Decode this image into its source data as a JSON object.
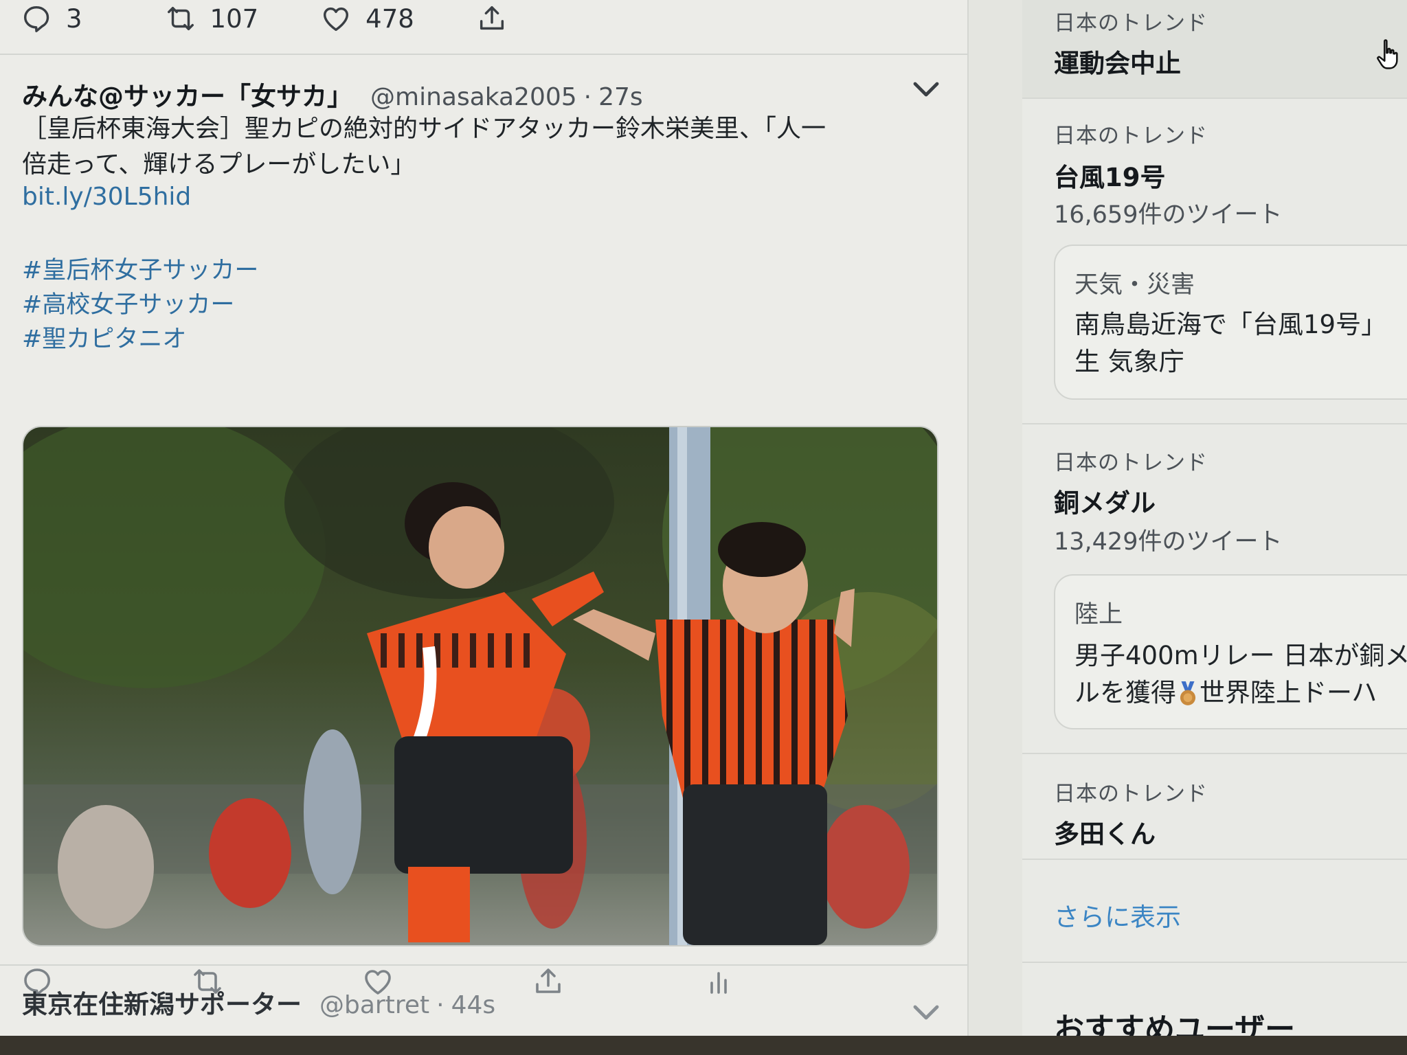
{
  "top_actions": {
    "reply_count": "3",
    "retweet_count": "107",
    "like_count": "478"
  },
  "tweet": {
    "author": "みんな@サッカー「女サカ」",
    "handle": "@minasaka2005",
    "separator": "·",
    "time": "27s",
    "text_line1": "［皇后杯東海大会］聖カピの絶対的サイドアタッカー鈴木栄美里、「人一",
    "text_line2": "倍走って、輝けるプレーがしたい」",
    "link": "bit.ly/30L5hid",
    "hashtags": [
      "#皇后杯女子サッカー",
      "#高校女子サッカー",
      "#聖カピタニオ"
    ]
  },
  "next_tweet": {
    "author": "東京在住新潟サポーター",
    "handle": "@bartret",
    "separator": "·",
    "time": "44s"
  },
  "sidebar": {
    "trend1": {
      "label": "日本のトレンド",
      "name": "運動会中止"
    },
    "trend2": {
      "label": "日本のトレンド",
      "name": "台風19号",
      "count": "16,659件のツイート"
    },
    "news1": {
      "category": "天気・災害",
      "line1": "南鳥島近海で「台風19号」",
      "line2": "生 気象庁"
    },
    "trend3": {
      "label": "日本のトレンド",
      "name": "銅メダル",
      "count": "13,429件のツイート"
    },
    "news2": {
      "category": "陸上",
      "line1": "男子400mリレー 日本が銅メ",
      "line2a": "ルを獲得",
      "line2b": "世界陸上ドーハ"
    },
    "trend4": {
      "label": "日本のトレンド",
      "name": "多田くん"
    },
    "show_more": "さらに表示",
    "recommend_title": "おすすめユーザー"
  },
  "colors": {
    "link": "#2f6ea0",
    "show_more": "#3b85c4",
    "jersey_orange": "#e8501f"
  },
  "icons": [
    "reply-icon",
    "retweet-icon",
    "like-icon",
    "share-icon",
    "analytics-icon",
    "chevron-down-icon",
    "hand-cursor-icon",
    "bronze-medal-icon"
  ]
}
